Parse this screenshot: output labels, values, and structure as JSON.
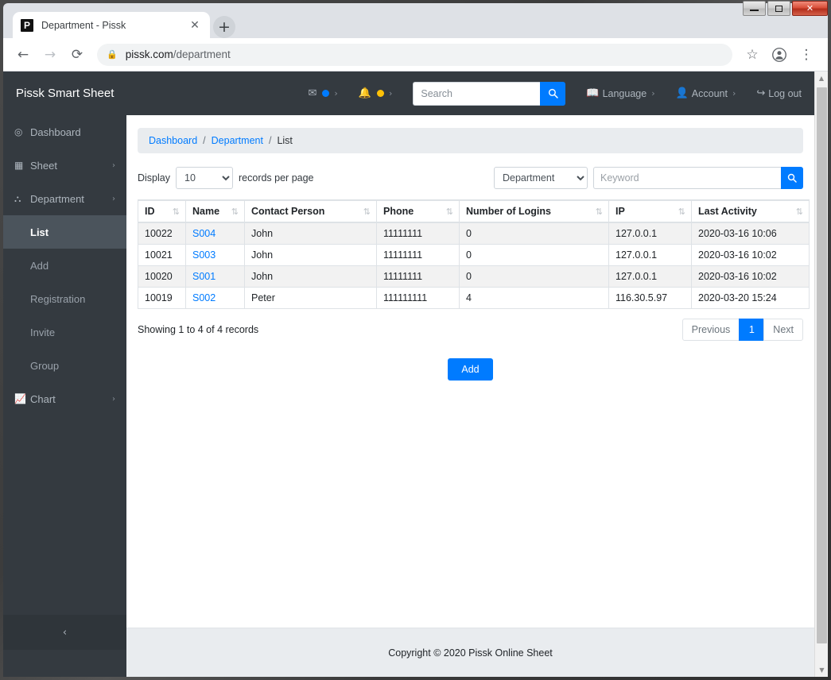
{
  "window": {
    "minimize_label": "minimize",
    "maximize_label": "maximize",
    "close_label": "✕"
  },
  "browser": {
    "tab": {
      "favicon_letter": "P",
      "title": "Department - Pissk",
      "close_glyph": "✕"
    },
    "new_tab_glyph": "+",
    "nav": {
      "back": "←",
      "forward": "→",
      "reload": "⟳"
    },
    "omnibox": {
      "lock": "🔒",
      "host": "pissk.com",
      "path": "/department"
    },
    "actions": {
      "bookmark": "☆",
      "profile": "●",
      "menu": "⋮"
    }
  },
  "header": {
    "brand": "Pissk Smart Sheet",
    "messages": {
      "icon": "✉",
      "caret": "›"
    },
    "notifications": {
      "icon": "🔔",
      "caret": "›"
    },
    "search": {
      "placeholder": "Search",
      "value": "",
      "button_icon": "🔍"
    },
    "language": {
      "icon": "📖",
      "label": "Language",
      "caret": "›"
    },
    "account": {
      "icon": "👤",
      "label": "Account",
      "caret": "›"
    },
    "logout": {
      "icon": "↪",
      "label": "Log out"
    }
  },
  "sidebar": {
    "items": [
      {
        "icon": "◉",
        "label": "Dashboard",
        "arrow": ""
      },
      {
        "icon": "▦",
        "label": "Sheet",
        "arrow": "›"
      },
      {
        "icon": "⛬",
        "label": "Department",
        "arrow": "›"
      }
    ],
    "sub_items": [
      {
        "label": "List",
        "active": true
      },
      {
        "label": "Add",
        "active": false
      },
      {
        "label": "Registration",
        "active": false
      },
      {
        "label": "Invite",
        "active": false
      },
      {
        "label": "Group",
        "active": false
      }
    ],
    "chart_item": {
      "icon": "▂▅▇",
      "label": "Chart",
      "arrow": "›"
    },
    "collapse_glyph": "‹"
  },
  "breadcrumb": {
    "dashboard": "Dashboard",
    "sep1": "/",
    "department": "Department",
    "sep2": "/",
    "current": "List"
  },
  "toolbar": {
    "display_label": "Display",
    "per_page_value": "10",
    "records_label": "records per page",
    "filter_value": "Department",
    "keyword_placeholder": "Keyword",
    "keyword_value": "",
    "keyword_button_icon": "🔍"
  },
  "table": {
    "sort_icon": "⇅",
    "columns": [
      "ID",
      "Name",
      "Contact Person",
      "Phone",
      "Number of Logins",
      "IP",
      "Last Activity"
    ],
    "rows": [
      {
        "id": "10022",
        "name": "S004",
        "contact": "John",
        "phone": "11111111",
        "logins": "0",
        "ip": "127.0.0.1",
        "last_activity": "2020-03-16 10:06"
      },
      {
        "id": "10021",
        "name": "S003",
        "contact": "John",
        "phone": "11111111",
        "logins": "0",
        "ip": "127.0.0.1",
        "last_activity": "2020-03-16 10:02"
      },
      {
        "id": "10020",
        "name": "S001",
        "contact": "John",
        "phone": "11111111",
        "logins": "0",
        "ip": "127.0.0.1",
        "last_activity": "2020-03-16 10:02"
      },
      {
        "id": "10019",
        "name": "S002",
        "contact": "Peter",
        "phone": "111111111",
        "logins": "4",
        "ip": "116.30.5.97",
        "last_activity": "2020-03-20 15:24"
      }
    ]
  },
  "footer_bar": {
    "showing": "Showing 1 to 4 of 4 records",
    "previous": "Previous",
    "page_1": "1",
    "next": "Next"
  },
  "add_button": "Add",
  "page_footer": "Copyright © 2020 Pissk Online Sheet",
  "scrollbar": {
    "up": "▲",
    "down": "▼"
  }
}
